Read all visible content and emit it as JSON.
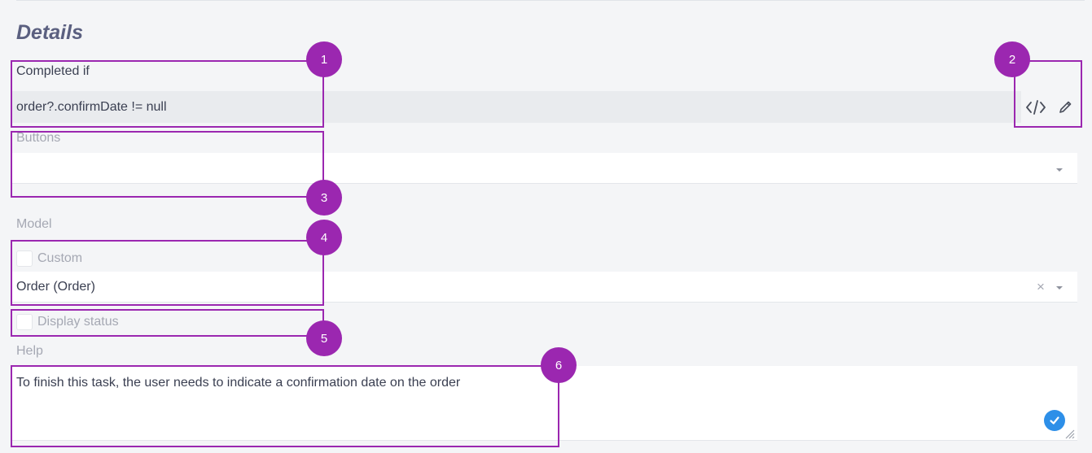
{
  "details": {
    "title": "Details",
    "completed_if": {
      "label": "Completed if",
      "value": "order?.confirmDate != null"
    },
    "buttons": {
      "label": "Buttons",
      "value": ""
    },
    "model": {
      "label": "Model",
      "custom_label": "Custom",
      "custom_checked": false,
      "value": "Order (Order)",
      "clear_glyph": "×"
    },
    "display_status": {
      "label": "Display status",
      "checked": false
    },
    "help": {
      "label": "Help",
      "value": "To finish this task, the user needs to indicate a confirmation date on the order"
    }
  },
  "callouts": [
    "1",
    "2",
    "3",
    "4",
    "5",
    "6"
  ],
  "colors": {
    "callout": "#9b27b0",
    "accent": "#2d8fe8"
  },
  "icons": {
    "code": "code-icon",
    "edit": "pencil-icon",
    "check": "check-icon",
    "dropdown": "caret-down-icon"
  }
}
